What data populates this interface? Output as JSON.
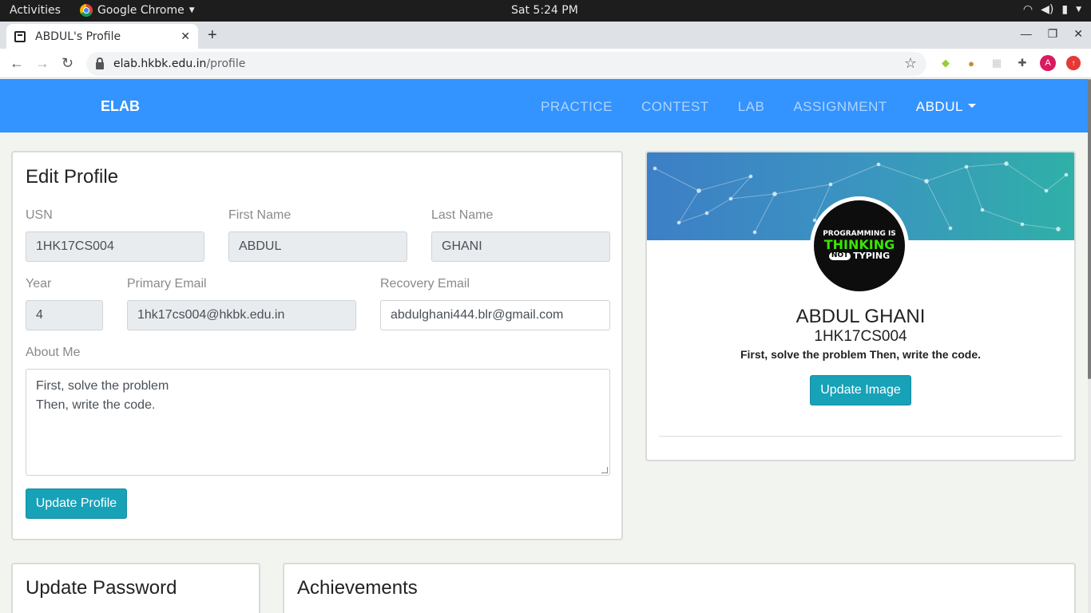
{
  "system": {
    "activities": "Activities",
    "app_name": "Google Chrome",
    "clock": "Sat  5:24 PM"
  },
  "browser": {
    "tab_title": "ABDUL's Profile",
    "url_host": "elab.hkbk.edu.in",
    "url_path": "/profile",
    "profile_initial": "A"
  },
  "site": {
    "brand": "ELAB",
    "nav": [
      "PRACTICE",
      "CONTEST",
      "LAB",
      "ASSIGNMENT"
    ],
    "user_menu": "ABDUL"
  },
  "edit_profile": {
    "title": "Edit Profile",
    "usn_label": "USN",
    "usn": "1HK17CS004",
    "first_name_label": "First Name",
    "first_name": "ABDUL",
    "last_name_label": "Last Name",
    "last_name": "GHANI",
    "year_label": "Year",
    "year": "4",
    "primary_email_label": "Primary Email",
    "primary_email": "1hk17cs004@hkbk.edu.in",
    "recovery_email_label": "Recovery Email",
    "recovery_email": "abdulghani444.blr@gmail.com",
    "about_label": "About Me",
    "about_line1": "First, solve the problem",
    "about_line2": "Then, write the code.",
    "update_button": "Update Profile"
  },
  "profile_card": {
    "image_text_1": "PROGRAMMING IS",
    "image_text_2": "THINKING",
    "image_text_3a": "NOT",
    "image_text_3b": "TYPING",
    "name": "ABDUL GHANI",
    "usn": "1HK17CS004",
    "about": "First, solve the problem Then, write the code.",
    "update_image_button": "Update Image"
  },
  "sections": {
    "update_password": "Update Password",
    "achievements": "Achievements"
  },
  "colors": {
    "navbar": "#3393ff",
    "button": "#17a2b8"
  }
}
